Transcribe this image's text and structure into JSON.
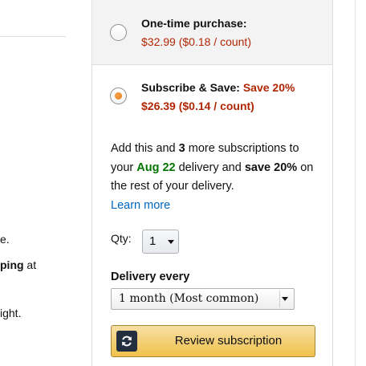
{
  "left_fragments": {
    "line1": "e.",
    "line2_bold": "ping",
    "line2_rest": " at",
    "line3": "ight."
  },
  "one_time": {
    "title": "One-time purchase:",
    "price": "$32.99 ($0.18 / count)",
    "selected": false
  },
  "subscribe": {
    "title": "Subscribe & Save:",
    "save_label": "Save 20%",
    "price": "$26.39 ($0.14 / count)",
    "selected": true,
    "promo": {
      "part1": "Add this and ",
      "count": "3",
      "part2": " more subscriptions to your ",
      "date": "Aug 22",
      "part3": " delivery and ",
      "save_word": "save",
      "pct": "20%",
      "part4": " on the rest of your delivery."
    },
    "learn_more": "Learn more"
  },
  "qty": {
    "label": "Qty:",
    "value": "1"
  },
  "delivery": {
    "label": "Delivery every",
    "value": "1 month (Most common)"
  },
  "review_button": {
    "label": "Review subscription",
    "icon": "refresh-icon"
  },
  "colors": {
    "price_red": "#b12704",
    "date_green": "#007600",
    "link_blue": "#0066c0",
    "button_yellow": "#f0c14b",
    "radio_orange": "#e47911"
  }
}
